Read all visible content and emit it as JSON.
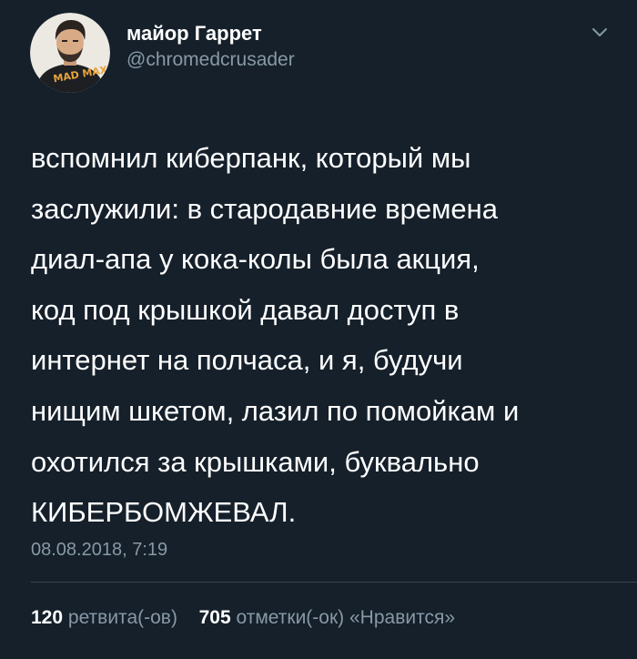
{
  "tweet": {
    "author": {
      "display_name": "майор Гаррет",
      "handle": "@chromedcrusader",
      "avatar_text": "MAD MAX"
    },
    "text_lines": [
      "вспомнил киберпанк, который мы",
      "заслужили: в стародавние времена",
      "диал-апа у кока-колы была акция,",
      "код под крышкой давал доступ в",
      "интернет на полчаса, и я, будучи",
      "нищим шкетом, лазил по помойкам и",
      "охотился за крышками, буквально",
      "КИБЕРБОМЖЕВАЛ."
    ],
    "timestamp": "08.08.2018, 7:19",
    "stats": {
      "retweets_count": "120",
      "retweets_label": "ретвита(-ов)",
      "likes_count": "705",
      "likes_label": "отметки(-ок) «Нравится»"
    }
  },
  "colors": {
    "background": "#15202b",
    "primary_text": "#ffffff",
    "secondary_text": "#8899a6",
    "divider": "#38444d"
  },
  "icons": {
    "menu": "chevron-down-icon"
  }
}
